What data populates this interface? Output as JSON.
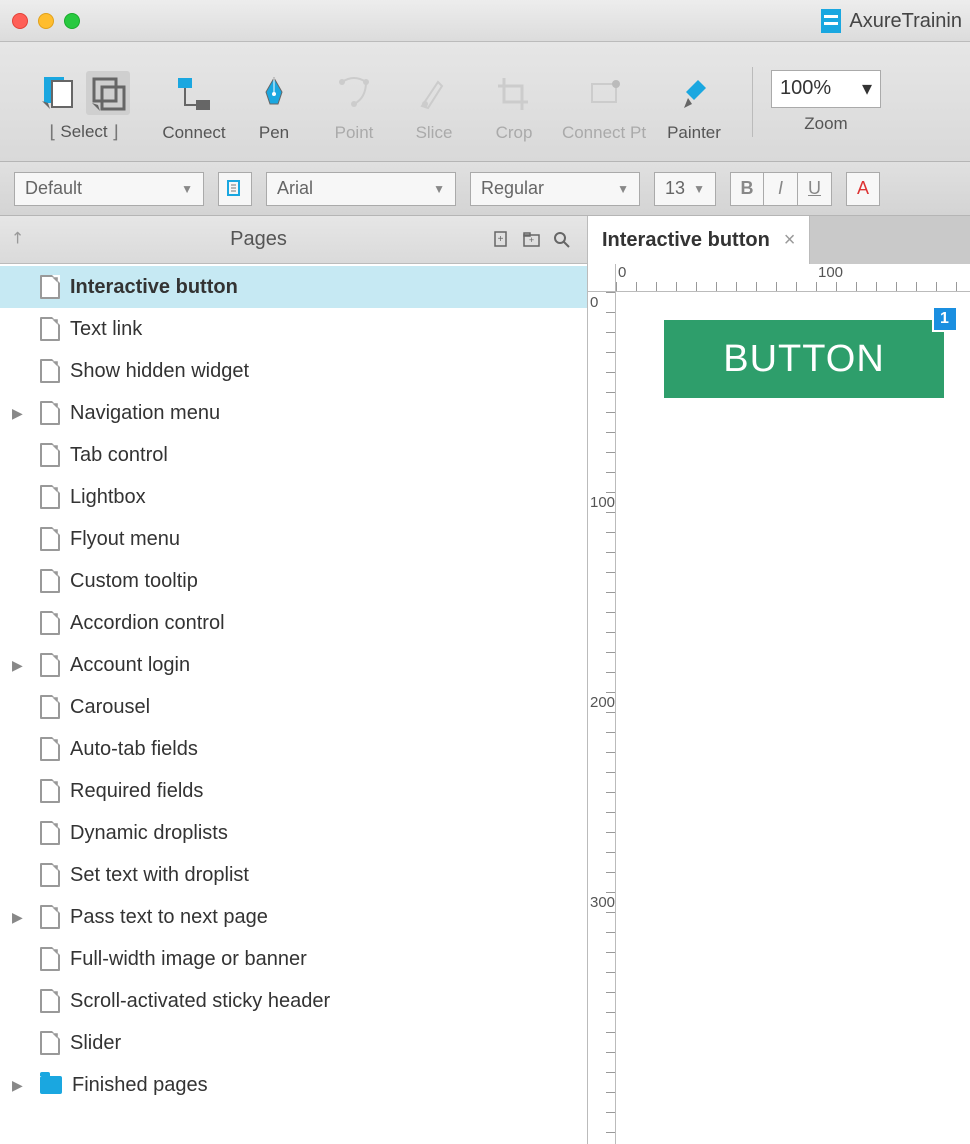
{
  "window": {
    "title": "AxureTrainin"
  },
  "toolbar": {
    "items": [
      {
        "label": "Select",
        "active": false,
        "disabled": false,
        "icon": "select"
      },
      {
        "label": "Connect",
        "active": false,
        "disabled": false,
        "icon": "connect"
      },
      {
        "label": "Pen",
        "active": false,
        "disabled": false,
        "icon": "pen"
      },
      {
        "label": "Point",
        "active": false,
        "disabled": true,
        "icon": "point"
      },
      {
        "label": "Slice",
        "active": false,
        "disabled": true,
        "icon": "slice"
      },
      {
        "label": "Crop",
        "active": false,
        "disabled": true,
        "icon": "crop"
      },
      {
        "label": "Connect Pt",
        "active": false,
        "disabled": true,
        "icon": "connectpt"
      },
      {
        "label": "Painter",
        "active": false,
        "disabled": false,
        "icon": "painter"
      }
    ],
    "zoom": {
      "value": "100%",
      "label": "Zoom"
    }
  },
  "formatbar": {
    "style": "Default",
    "font": "Arial",
    "weight": "Regular",
    "size": "13"
  },
  "pages_panel": {
    "title": "Pages",
    "items": [
      {
        "label": "Interactive button",
        "selected": true,
        "expandable": false,
        "type": "page"
      },
      {
        "label": "Text link",
        "selected": false,
        "expandable": false,
        "type": "page"
      },
      {
        "label": "Show hidden widget",
        "selected": false,
        "expandable": false,
        "type": "page"
      },
      {
        "label": "Navigation menu",
        "selected": false,
        "expandable": true,
        "type": "page"
      },
      {
        "label": "Tab control",
        "selected": false,
        "expandable": false,
        "type": "page"
      },
      {
        "label": "Lightbox",
        "selected": false,
        "expandable": false,
        "type": "page"
      },
      {
        "label": "Flyout menu",
        "selected": false,
        "expandable": false,
        "type": "page"
      },
      {
        "label": "Custom tooltip",
        "selected": false,
        "expandable": false,
        "type": "page"
      },
      {
        "label": "Accordion control",
        "selected": false,
        "expandable": false,
        "type": "page"
      },
      {
        "label": "Account login",
        "selected": false,
        "expandable": true,
        "type": "page"
      },
      {
        "label": "Carousel",
        "selected": false,
        "expandable": false,
        "type": "page"
      },
      {
        "label": "Auto-tab fields",
        "selected": false,
        "expandable": false,
        "type": "page"
      },
      {
        "label": "Required fields",
        "selected": false,
        "expandable": false,
        "type": "page"
      },
      {
        "label": "Dynamic droplists",
        "selected": false,
        "expandable": false,
        "type": "page"
      },
      {
        "label": "Set text with droplist",
        "selected": false,
        "expandable": false,
        "type": "page"
      },
      {
        "label": "Pass text to next page",
        "selected": false,
        "expandable": true,
        "type": "page"
      },
      {
        "label": "Full-width image or banner",
        "selected": false,
        "expandable": false,
        "type": "page"
      },
      {
        "label": "Scroll-activated sticky header",
        "selected": false,
        "expandable": false,
        "type": "page"
      },
      {
        "label": "Slider",
        "selected": false,
        "expandable": false,
        "type": "page"
      },
      {
        "label": "Finished pages",
        "selected": false,
        "expandable": true,
        "type": "folder"
      }
    ]
  },
  "canvas": {
    "tab": "Interactive button",
    "ruler_h": [
      "0",
      "100"
    ],
    "ruler_v": [
      "0",
      "100",
      "200",
      "300"
    ],
    "widget": {
      "text": "BUTTON",
      "badge": "1",
      "fill": "#2e9e6b"
    }
  }
}
